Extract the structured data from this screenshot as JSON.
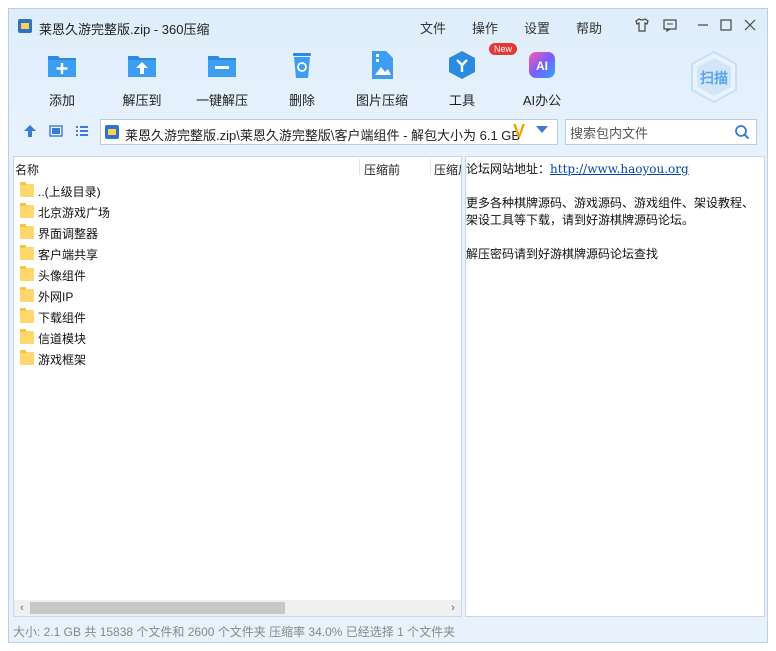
{
  "window": {
    "title": "莱恩久游完整版.zip - 360压缩",
    "menu": [
      "文件",
      "操作",
      "设置",
      "帮助"
    ],
    "title_icons": [
      "shirt-icon",
      "feedback-icon",
      "minimize-icon",
      "maximize-icon",
      "close-icon"
    ]
  },
  "toolbar": {
    "items": [
      {
        "label": "添加",
        "icon": "add-icon"
      },
      {
        "label": "解压到",
        "icon": "extract-to-icon"
      },
      {
        "label": "一键解压",
        "icon": "one-click-extract-icon"
      },
      {
        "label": "删除",
        "icon": "delete-icon"
      },
      {
        "label": "图片压缩",
        "icon": "image-compress-icon"
      },
      {
        "label": "工具",
        "icon": "tools-icon"
      },
      {
        "label": "AI办公",
        "icon": "ai-office-icon"
      }
    ],
    "new_badge": "New",
    "scan_label": "扫描"
  },
  "address": {
    "path": "莱恩久游完整版.zip\\莱恩久游完整版\\客户端组件 - 解包大小为 6.1 GB",
    "v_mark": "V"
  },
  "search": {
    "placeholder": "搜索包内文件"
  },
  "filelist": {
    "columns": [
      "名称",
      "压缩前",
      "压缩后"
    ],
    "rows": [
      "..(上级目录)",
      "北京游戏广场",
      "界面调整器",
      "客户端共享",
      "头像组件",
      "外网IP",
      "下载组件",
      "信道模块",
      "游戏框架"
    ]
  },
  "comment": {
    "line1_label": "论坛网站地址：",
    "line1_link": "http://www.haoyou.org",
    "line2": "更多各种棋牌源码、游戏源码、游戏组件、架设教程、",
    "line3": "架设工具等下载，请到好游棋牌源码论坛。",
    "line4": "解压密码请到好游棋牌源码论坛查找"
  },
  "status": {
    "text": "大小: 2.1 GB 共 15838 个文件和 2600 个文件夹 压缩率 34.0% 已经选择 1 个文件夹"
  },
  "colors": {
    "accent": "#2a8be0",
    "folder": "#ffd76a",
    "badge": "#e53935"
  }
}
